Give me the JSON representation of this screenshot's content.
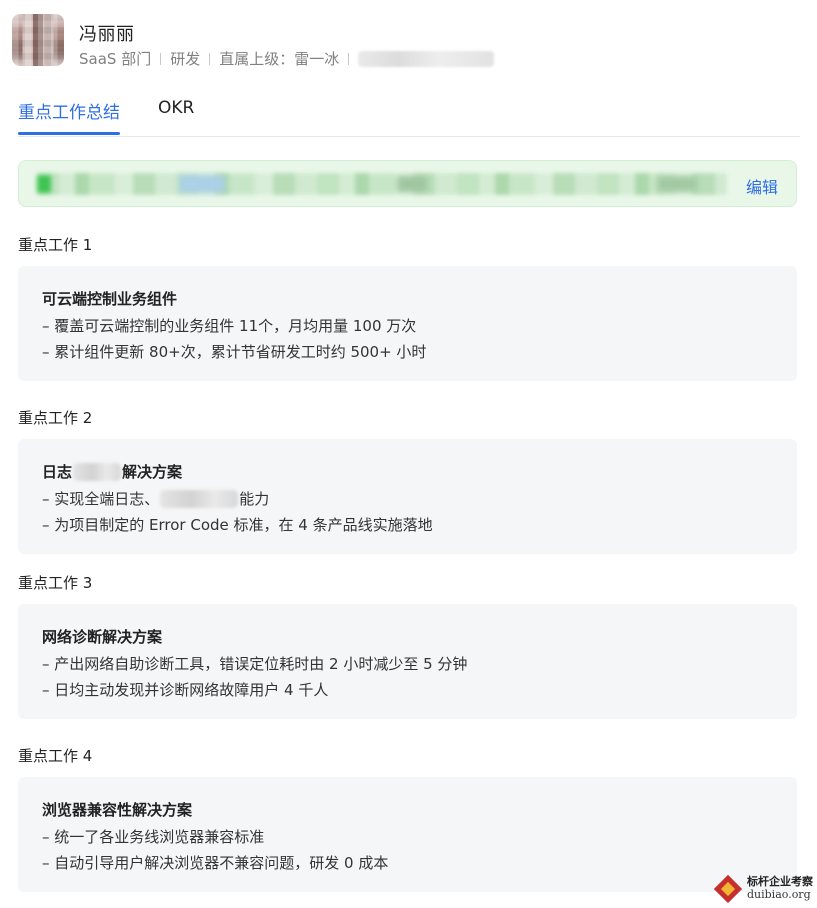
{
  "user": {
    "name": "冯丽丽",
    "department": "SaaS 部门",
    "role": "研发",
    "manager_label": "直属上级：雷一冰"
  },
  "tabs": [
    {
      "label": "重点工作总结",
      "active": true
    },
    {
      "label": "OKR",
      "active": false
    }
  ],
  "notice": {
    "edit_label": "编辑"
  },
  "sections": [
    {
      "title": "重点工作 1",
      "heading": "可云端控制业务组件",
      "lines": [
        "– 覆盖可云端控制的业务组件 11个，月均用量 100 万次",
        "– 累计组件更新 80+次，累计节省研发工时约 500+ 小时"
      ]
    },
    {
      "title": "重点工作 2",
      "heading_pre": "日志",
      "heading_post": "解决方案",
      "line1_pre": "– 实现全端日志、",
      "line1_post": "能力",
      "line2": "– 为项目制定的 Error Code 标准，在 4 条产品线实施落地"
    },
    {
      "title": "重点工作 3",
      "heading": "网络诊断解决方案",
      "lines": [
        "– 产出网络自助诊断工具，错误定位耗时由 2 小时减少至 5 分钟",
        "– 日均主动发现并诊断网络故障用户 4 千人"
      ]
    },
    {
      "title": "重点工作 4",
      "heading": "浏览器兼容性解决方案",
      "lines": [
        "– 统一了各业务线浏览器兼容标准",
        "– 自动引导用户解决浏览器不兼容问题，研发 0 成本"
      ]
    }
  ],
  "watermark": {
    "cn": "标杆企业考察",
    "en": "duibiao.org"
  },
  "colors": {
    "accent": "#2f6fe4",
    "notice_bg": "#e9f7e9",
    "card_bg": "#f5f6f8"
  }
}
